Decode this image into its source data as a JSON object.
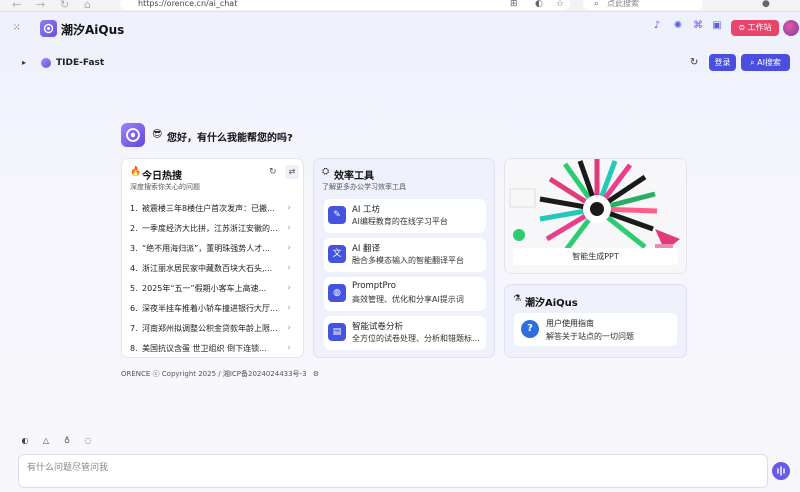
{
  "browser": {
    "url": "https://orence.cn/ai_chat",
    "search_placeholder": "点此搜索"
  },
  "app": {
    "name": "潮汐AiQus",
    "workstation_label": "工作站",
    "model_name": "TIDE-Fast",
    "login_label": "登录",
    "ai_search_label": "AI搜索"
  },
  "greeting": "您好，有什么我能帮您的吗?",
  "hot": {
    "title": "今日热搜",
    "subtitle": "深度搜索你关心的问题",
    "items": [
      {
        "num": "1.",
        "text": "被震楼三年8楼住户首次发声：已搬..."
      },
      {
        "num": "2.",
        "text": "一季度经济大比拼，江苏浙江安徽的..."
      },
      {
        "num": "3.",
        "text": "“绝不用海归派”，董明珠强势人才..."
      },
      {
        "num": "4.",
        "text": "浙江丽水居民家中藏数百块大石头,..."
      },
      {
        "num": "5.",
        "text": "2025年“五一”假期小客车上高速..."
      },
      {
        "num": "6.",
        "text": "深夜半挂车推着小轿车撞进银行大厅..."
      },
      {
        "num": "7.",
        "text": "河南郑州拟调整公积金贷款年龄上限..."
      },
      {
        "num": "8.",
        "text": "美国抗议含蛋 世卫组织 倒下连锁..."
      }
    ]
  },
  "tools": {
    "title": "效率工具",
    "subtitle": "了解更多办公学习效率工具",
    "items": [
      {
        "name": "AI 工坊",
        "desc": "AI编程教育的在线学习平台",
        "icon": "workshop-icon"
      },
      {
        "name": "AI 翻译",
        "desc": "融合多模态输入的智能翻译平台",
        "icon": "translate-icon"
      },
      {
        "name": "PromptPro",
        "desc": "高效管理、优化和分享AI提示词",
        "icon": "prompt-icon"
      },
      {
        "name": "智能试卷分析",
        "desc": "全方位的试卷处理、分析和错题标...",
        "icon": "exam-icon"
      }
    ]
  },
  "ppt": {
    "label": "智能生成PPT"
  },
  "aiqus": {
    "title": "潮汐AiQus",
    "guide_title": "用户使用指南",
    "guide_desc": "解答关于站点的一切问题"
  },
  "footer": "ORENCE ⓒ Copyright 2025 / 湘ICP备2024024433号-3",
  "input": {
    "placeholder": "有什么问题尽管问我"
  },
  "colors": {
    "accent": "#4b4fe0",
    "workstation": "#e8456b"
  }
}
